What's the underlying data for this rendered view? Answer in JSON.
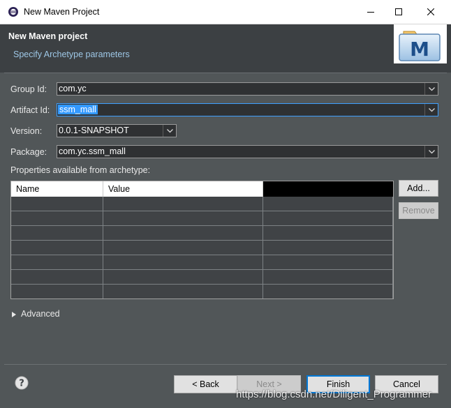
{
  "window": {
    "title": "New Maven Project"
  },
  "header": {
    "title": "New Maven project",
    "subtitle": "Specify Archetype parameters",
    "logo_letter": "M"
  },
  "form": {
    "group_id": {
      "label": "Group Id:",
      "value": "com.yc"
    },
    "artifact_id": {
      "label": "Artifact Id:",
      "value": "ssm_mall"
    },
    "version": {
      "label": "Version:",
      "value": "0.0.1-SNAPSHOT"
    },
    "package": {
      "label": "Package:",
      "value": "com.yc.ssm_mall"
    },
    "properties_label": "Properties available from archetype:"
  },
  "table": {
    "columns": [
      "Name",
      "Value"
    ],
    "rows": [
      [
        "",
        ""
      ],
      [
        "",
        ""
      ],
      [
        "",
        ""
      ],
      [
        "",
        ""
      ],
      [
        "",
        ""
      ],
      [
        "",
        ""
      ],
      [
        "",
        ""
      ]
    ]
  },
  "side_buttons": {
    "add": "Add...",
    "remove": "Remove"
  },
  "advanced_label": "Advanced",
  "footer": {
    "back": "< Back",
    "next": "Next >",
    "finish": "Finish",
    "cancel": "Cancel"
  },
  "watermark": "https://blog.csdn.net/Diligent_Programmer",
  "colors": {
    "dialog_bg": "#515658",
    "header_bg": "#3c4043",
    "subtitle": "#9ec7e6",
    "selection": "#3399ff",
    "focus_border": "#3fa0ff",
    "default_button_border": "#0078d7"
  },
  "icons": [
    "eclipse-app-icon",
    "minimize-icon",
    "maximize-icon",
    "close-icon",
    "maven-logo-icon",
    "chevron-down-icon",
    "expand-triangle-icon",
    "help-icon"
  ]
}
